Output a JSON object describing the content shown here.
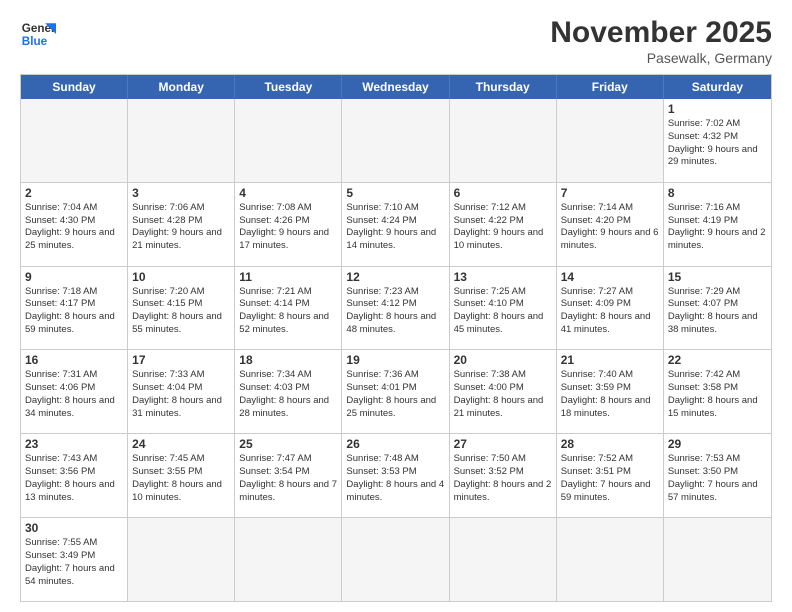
{
  "header": {
    "logo_general": "General",
    "logo_blue": "Blue",
    "month_year": "November 2025",
    "location": "Pasewalk, Germany"
  },
  "day_headers": [
    "Sunday",
    "Monday",
    "Tuesday",
    "Wednesday",
    "Thursday",
    "Friday",
    "Saturday"
  ],
  "cells": [
    {
      "day": "",
      "info": "",
      "empty": true
    },
    {
      "day": "",
      "info": "",
      "empty": true
    },
    {
      "day": "",
      "info": "",
      "empty": true
    },
    {
      "day": "",
      "info": "",
      "empty": true
    },
    {
      "day": "",
      "info": "",
      "empty": true
    },
    {
      "day": "",
      "info": "",
      "empty": true
    },
    {
      "day": "1",
      "info": "Sunrise: 7:02 AM\nSunset: 4:32 PM\nDaylight: 9 hours\nand 29 minutes."
    },
    {
      "day": "2",
      "info": "Sunrise: 7:04 AM\nSunset: 4:30 PM\nDaylight: 9 hours\nand 25 minutes."
    },
    {
      "day": "3",
      "info": "Sunrise: 7:06 AM\nSunset: 4:28 PM\nDaylight: 9 hours\nand 21 minutes."
    },
    {
      "day": "4",
      "info": "Sunrise: 7:08 AM\nSunset: 4:26 PM\nDaylight: 9 hours\nand 17 minutes."
    },
    {
      "day": "5",
      "info": "Sunrise: 7:10 AM\nSunset: 4:24 PM\nDaylight: 9 hours\nand 14 minutes."
    },
    {
      "day": "6",
      "info": "Sunrise: 7:12 AM\nSunset: 4:22 PM\nDaylight: 9 hours\nand 10 minutes."
    },
    {
      "day": "7",
      "info": "Sunrise: 7:14 AM\nSunset: 4:20 PM\nDaylight: 9 hours\nand 6 minutes."
    },
    {
      "day": "8",
      "info": "Sunrise: 7:16 AM\nSunset: 4:19 PM\nDaylight: 9 hours\nand 2 minutes."
    },
    {
      "day": "9",
      "info": "Sunrise: 7:18 AM\nSunset: 4:17 PM\nDaylight: 8 hours\nand 59 minutes."
    },
    {
      "day": "10",
      "info": "Sunrise: 7:20 AM\nSunset: 4:15 PM\nDaylight: 8 hours\nand 55 minutes."
    },
    {
      "day": "11",
      "info": "Sunrise: 7:21 AM\nSunset: 4:14 PM\nDaylight: 8 hours\nand 52 minutes."
    },
    {
      "day": "12",
      "info": "Sunrise: 7:23 AM\nSunset: 4:12 PM\nDaylight: 8 hours\nand 48 minutes."
    },
    {
      "day": "13",
      "info": "Sunrise: 7:25 AM\nSunset: 4:10 PM\nDaylight: 8 hours\nand 45 minutes."
    },
    {
      "day": "14",
      "info": "Sunrise: 7:27 AM\nSunset: 4:09 PM\nDaylight: 8 hours\nand 41 minutes."
    },
    {
      "day": "15",
      "info": "Sunrise: 7:29 AM\nSunset: 4:07 PM\nDaylight: 8 hours\nand 38 minutes."
    },
    {
      "day": "16",
      "info": "Sunrise: 7:31 AM\nSunset: 4:06 PM\nDaylight: 8 hours\nand 34 minutes."
    },
    {
      "day": "17",
      "info": "Sunrise: 7:33 AM\nSunset: 4:04 PM\nDaylight: 8 hours\nand 31 minutes."
    },
    {
      "day": "18",
      "info": "Sunrise: 7:34 AM\nSunset: 4:03 PM\nDaylight: 8 hours\nand 28 minutes."
    },
    {
      "day": "19",
      "info": "Sunrise: 7:36 AM\nSunset: 4:01 PM\nDaylight: 8 hours\nand 25 minutes."
    },
    {
      "day": "20",
      "info": "Sunrise: 7:38 AM\nSunset: 4:00 PM\nDaylight: 8 hours\nand 21 minutes."
    },
    {
      "day": "21",
      "info": "Sunrise: 7:40 AM\nSunset: 3:59 PM\nDaylight: 8 hours\nand 18 minutes."
    },
    {
      "day": "22",
      "info": "Sunrise: 7:42 AM\nSunset: 3:58 PM\nDaylight: 8 hours\nand 15 minutes."
    },
    {
      "day": "23",
      "info": "Sunrise: 7:43 AM\nSunset: 3:56 PM\nDaylight: 8 hours\nand 13 minutes."
    },
    {
      "day": "24",
      "info": "Sunrise: 7:45 AM\nSunset: 3:55 PM\nDaylight: 8 hours\nand 10 minutes."
    },
    {
      "day": "25",
      "info": "Sunrise: 7:47 AM\nSunset: 3:54 PM\nDaylight: 8 hours\nand 7 minutes."
    },
    {
      "day": "26",
      "info": "Sunrise: 7:48 AM\nSunset: 3:53 PM\nDaylight: 8 hours\nand 4 minutes."
    },
    {
      "day": "27",
      "info": "Sunrise: 7:50 AM\nSunset: 3:52 PM\nDaylight: 8 hours\nand 2 minutes."
    },
    {
      "day": "28",
      "info": "Sunrise: 7:52 AM\nSunset: 3:51 PM\nDaylight: 7 hours\nand 59 minutes."
    },
    {
      "day": "29",
      "info": "Sunrise: 7:53 AM\nSunset: 3:50 PM\nDaylight: 7 hours\nand 57 minutes."
    },
    {
      "day": "30",
      "info": "Sunrise: 7:55 AM\nSunset: 3:49 PM\nDaylight: 7 hours\nand 54 minutes."
    },
    {
      "day": "",
      "info": "",
      "empty": true
    },
    {
      "day": "",
      "info": "",
      "empty": true
    },
    {
      "day": "",
      "info": "",
      "empty": true
    },
    {
      "day": "",
      "info": "",
      "empty": true
    },
    {
      "day": "",
      "info": "",
      "empty": true
    },
    {
      "day": "",
      "info": "",
      "empty": true
    }
  ]
}
